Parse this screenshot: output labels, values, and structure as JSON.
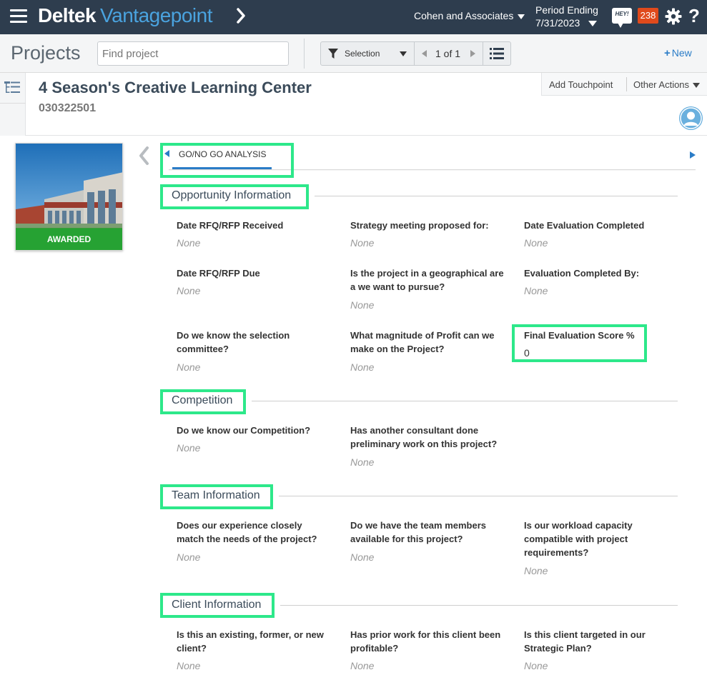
{
  "header": {
    "brand_first": "Deltek",
    "brand_second": "Vantagepoint",
    "company": "Cohen and Associates",
    "period_line1": "Period Ending",
    "period_line2": "7/31/2023",
    "hey_label": "HEY!",
    "notification_count": "238",
    "help_label": "?"
  },
  "toolbar": {
    "page_title": "Projects",
    "search_placeholder": "Find project",
    "selection_label": "Selection",
    "pager_text": "1 of 1",
    "new_label": "New"
  },
  "record": {
    "title": "4 Season's Creative Learning Center",
    "number": "030322501",
    "add_touchpoint": "Add Touchpoint",
    "other_actions": "Other Actions",
    "image_status": "AWARDED"
  },
  "tabs": {
    "active": "GO/NO GO ANALYSIS"
  },
  "sections": {
    "opportunity": {
      "title": "Opportunity Information",
      "fields": [
        {
          "label": "Date RFQ/RFP Received",
          "value": "None"
        },
        {
          "label": "Strategy meeting proposed for:",
          "value": "None"
        },
        {
          "label": "Date Evaluation Completed",
          "value": "None"
        },
        {
          "label": "Date RFQ/RFP Due",
          "value": "None"
        },
        {
          "label": "Is the project in a geographical are a we want to pursue?",
          "value": "None"
        },
        {
          "label": "Evaluation Completed By:",
          "value": "None"
        },
        {
          "label": "Do we know the selection committee?",
          "value": "None"
        },
        {
          "label": "What magnitude of Profit can we make on the Project?",
          "value": "None"
        },
        {
          "label": "Final Evaluation Score %",
          "value": "0"
        }
      ]
    },
    "competition": {
      "title": "Competition",
      "fields": [
        {
          "label": "Do we know our Competition?",
          "value": "None"
        },
        {
          "label": "Has another consultant done preliminary work on this project?",
          "value": "None"
        }
      ]
    },
    "team": {
      "title": "Team Information",
      "fields": [
        {
          "label": "Does our experience closely match the needs of the project?",
          "value": "None"
        },
        {
          "label": "Do we have the team members available for this project?",
          "value": "None"
        },
        {
          "label": "Is our workload capacity compatible with project requirements?",
          "value": "None"
        }
      ]
    },
    "client": {
      "title": "Client Information",
      "fields": [
        {
          "label": "Is this an existing, former, or new client?",
          "value": "None"
        },
        {
          "label": "Has prior work for this client been profitable?",
          "value": "None"
        },
        {
          "label": "Is this client targeted in our Strategic Plan?",
          "value": "None"
        }
      ]
    }
  },
  "colors": {
    "header_bg": "#2e3d4e",
    "brand_accent": "#4aa3df",
    "link_blue": "#2a7cc7",
    "badge_red": "#e04a1c",
    "awarded_green": "#26a233",
    "highlight_green": "#2de88a"
  },
  "icons": [
    "hamburger-icon",
    "chevron-right-icon",
    "hey-chat-icon",
    "gear-icon",
    "help-icon",
    "filter-icon",
    "list-view-icon",
    "tree-view-icon",
    "avatar-icon",
    "chevron-left-icon"
  ]
}
